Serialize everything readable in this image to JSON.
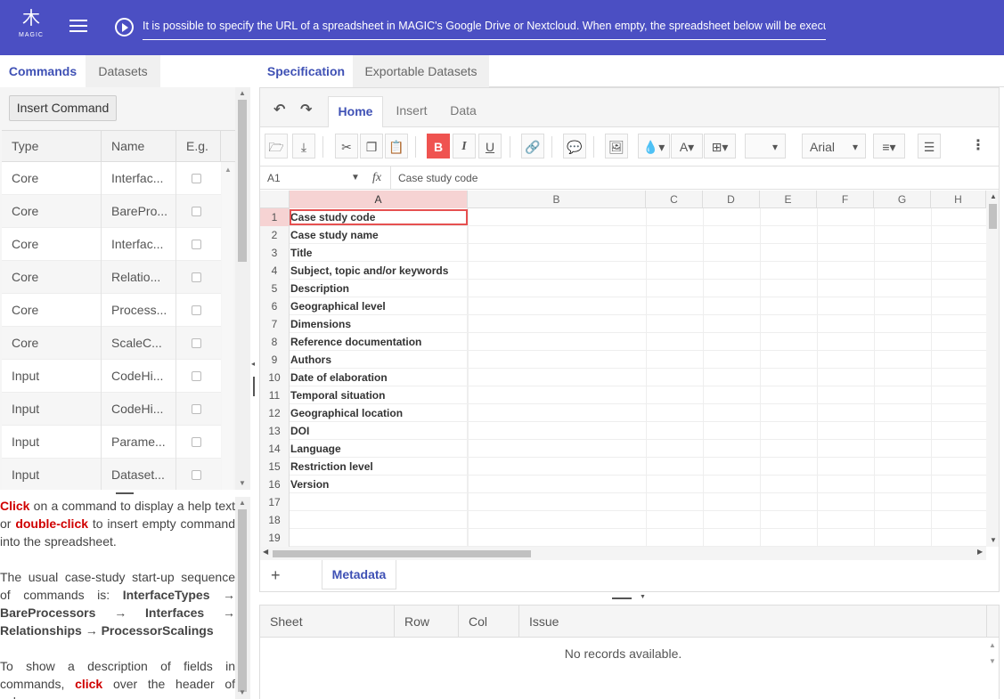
{
  "header": {
    "logo_text": "MAGIC",
    "url_text": "It is possible to specify the URL of a spreadsheet in MAGIC's Google Drive or Nextcloud. When empty, the spreadsheet below will be executed."
  },
  "left": {
    "tabs": [
      "Commands",
      "Datasets"
    ],
    "insert_button": "Insert Command",
    "columns": [
      "Type",
      "Name",
      "E.g."
    ],
    "rows": [
      {
        "type": "Core",
        "name": "Interfac..."
      },
      {
        "type": "Core",
        "name": "BarePro..."
      },
      {
        "type": "Core",
        "name": "Interfac..."
      },
      {
        "type": "Core",
        "name": "Relatio..."
      },
      {
        "type": "Core",
        "name": "Process..."
      },
      {
        "type": "Core",
        "name": "ScaleC..."
      },
      {
        "type": "Input",
        "name": "CodeHi..."
      },
      {
        "type": "Input",
        "name": "CodeHi..."
      },
      {
        "type": "Input",
        "name": "Parame..."
      },
      {
        "type": "Input",
        "name": "Dataset..."
      }
    ],
    "help": {
      "p1_click": "Click",
      "p1_a": "on a command to display a help text or",
      "p1_dblclick": "double-click",
      "p1_b": "to insert empty command into the spreadsheet.",
      "p2_a": "The usual case-study start-up sequence of commands is:",
      "seq1": "InterfaceTypes",
      "seq2": "BareProcessors",
      "seq3": "Interfaces",
      "seq4": "Relationships",
      "seq5": "ProcessorScalings",
      "arrow": "→",
      "p3_a": "To show a description of fields in commands,",
      "p3_click": "click",
      "p3_b": "over the header of columns."
    }
  },
  "right": {
    "tabs": [
      "Specification",
      "Exportable Datasets"
    ],
    "ribbon_tabs": [
      "Home",
      "Insert",
      "Data"
    ],
    "font_name": "Arial",
    "cell_ref": "A1",
    "formula": "Case study code",
    "columns": [
      "A",
      "B",
      "C",
      "D",
      "E",
      "F",
      "G",
      "H"
    ],
    "rows": [
      {
        "n": "1",
        "a": "Case study code"
      },
      {
        "n": "2",
        "a": "Case study name"
      },
      {
        "n": "3",
        "a": "Title"
      },
      {
        "n": "4",
        "a": "Subject, topic and/or keywords"
      },
      {
        "n": "5",
        "a": "Description"
      },
      {
        "n": "6",
        "a": "Geographical level"
      },
      {
        "n": "7",
        "a": "Dimensions"
      },
      {
        "n": "8",
        "a": "Reference documentation"
      },
      {
        "n": "9",
        "a": "Authors"
      },
      {
        "n": "10",
        "a": "Date of elaboration"
      },
      {
        "n": "11",
        "a": "Temporal situation"
      },
      {
        "n": "12",
        "a": "Geographical location"
      },
      {
        "n": "13",
        "a": "DOI"
      },
      {
        "n": "14",
        "a": "Language"
      },
      {
        "n": "15",
        "a": "Restriction level"
      },
      {
        "n": "16",
        "a": "Version"
      },
      {
        "n": "17",
        "a": ""
      },
      {
        "n": "18",
        "a": ""
      },
      {
        "n": "19",
        "a": ""
      }
    ],
    "sheet_tab": "Metadata",
    "add_sheet": "+",
    "issues": {
      "columns": [
        "Sheet",
        "Row",
        "Col",
        "Issue"
      ],
      "empty_text": "No records available."
    }
  }
}
